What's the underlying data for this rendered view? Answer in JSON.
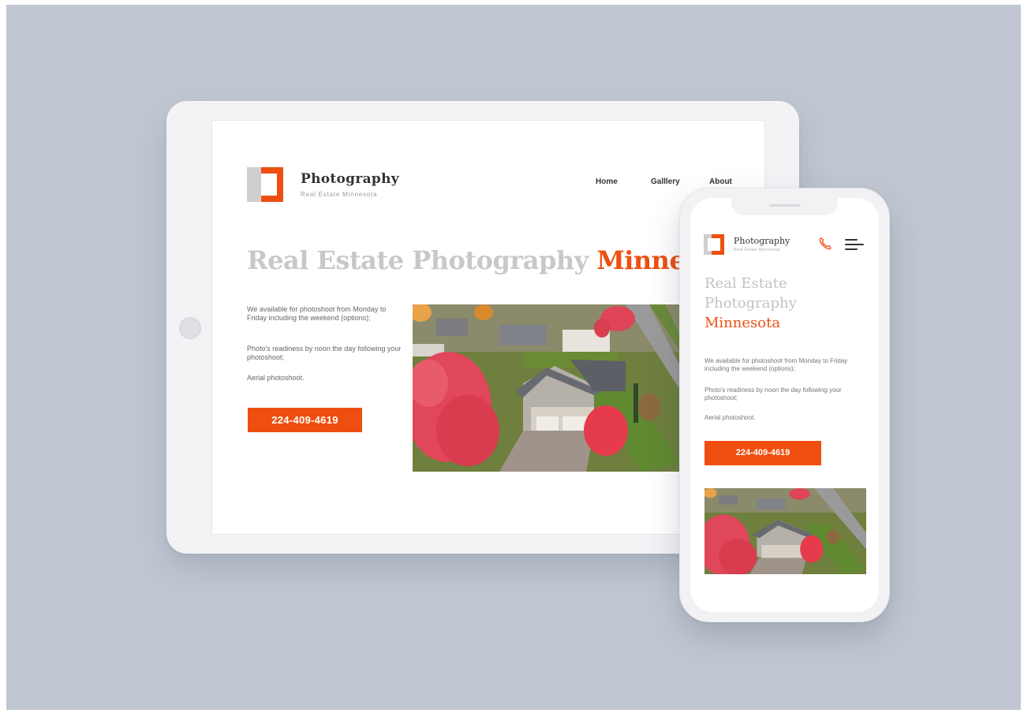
{
  "brand": {
    "name": "Photography",
    "tagline": "Real Estate Minnesota",
    "accent_color": "#ee4f10",
    "muted_color": "#cfcfd2"
  },
  "tablet": {
    "nav": [
      {
        "label": "Home"
      },
      {
        "label": "Galllery"
      },
      {
        "label": "About"
      }
    ],
    "hero": {
      "grey_text": "Real Estate Photography",
      "orange_text": "Minnesota"
    },
    "paragraphs": [
      "We available for photoshoot from Monday to Friday including the weekend (options);",
      "Photo's readiness by noon the day following your photoshoot;",
      "Aerial photoshoot."
    ],
    "cta_label": "224-409-4619"
  },
  "phone": {
    "call_icon": "phone-icon",
    "menu_icon": "hamburger-menu-icon",
    "hero": {
      "grey_line_1": "Real Estate",
      "grey_line_2": "Photography",
      "orange_line": "Minnesota"
    },
    "paragraphs": [
      "We available for photoshoot from Monday to Friday including the weekend (options);",
      "Photo's readiness by noon the day following your photoshoot;",
      "Aerial photoshoot."
    ],
    "cta_label": "224-409-4619"
  }
}
